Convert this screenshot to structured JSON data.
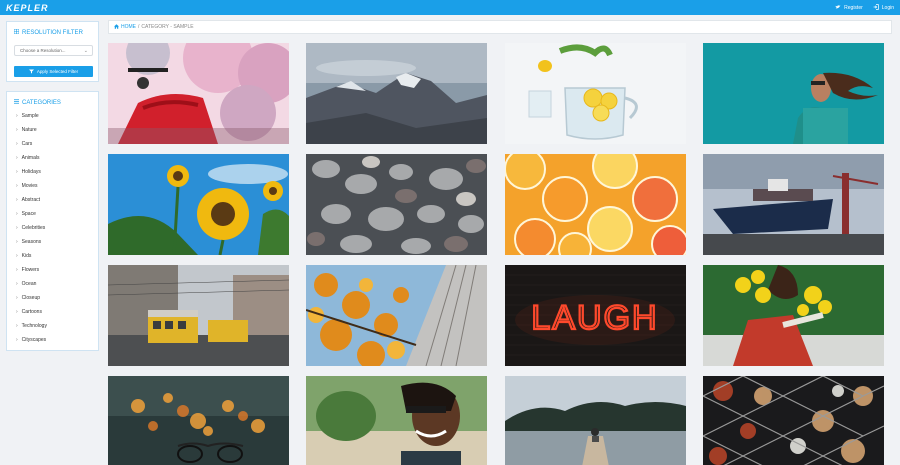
{
  "header": {
    "logo": "KEPLER",
    "register_label": "Register",
    "login_label": "Login"
  },
  "resolution_filter": {
    "title": "RESOLUTION FILTER",
    "select_value": "Choose a Resolution...",
    "apply_label": "Apply Selected Filter"
  },
  "categories": {
    "title": "CATEGORIES",
    "items": [
      "Sample",
      "Nature",
      "Cars",
      "Animals",
      "Holidays",
      "Movies",
      "Abstract",
      "Space",
      "Celebrities",
      "Seasons",
      "Kids",
      "Flowers",
      "Ocean",
      "Closeup",
      "Cartoons",
      "Technology",
      "Cityscapes"
    ]
  },
  "breadcrumb": {
    "home": "HOME",
    "sep": "/",
    "rest": "CATEGORY - SAMPLE"
  },
  "gallery": {
    "images": [
      {
        "subject": "red scooter with cherry blossoms"
      },
      {
        "subject": "misty mountain peak"
      },
      {
        "subject": "lemon water pitcher"
      },
      {
        "subject": "woman against teal sky"
      },
      {
        "subject": "sunflowers blue sky"
      },
      {
        "subject": "pebbles"
      },
      {
        "subject": "citrus slices"
      },
      {
        "subject": "cargo ship at port"
      },
      {
        "subject": "tram on rainy street"
      },
      {
        "subject": "autumn leaves and building"
      },
      {
        "subject": "LAUGH neon sign",
        "text": "LAUGH"
      },
      {
        "subject": "woman with yellow flowers"
      },
      {
        "subject": "glasses with bokeh"
      },
      {
        "subject": "smiling man with sunglasses"
      },
      {
        "subject": "pier on lake"
      },
      {
        "subject": "chain fence bokeh"
      }
    ]
  }
}
